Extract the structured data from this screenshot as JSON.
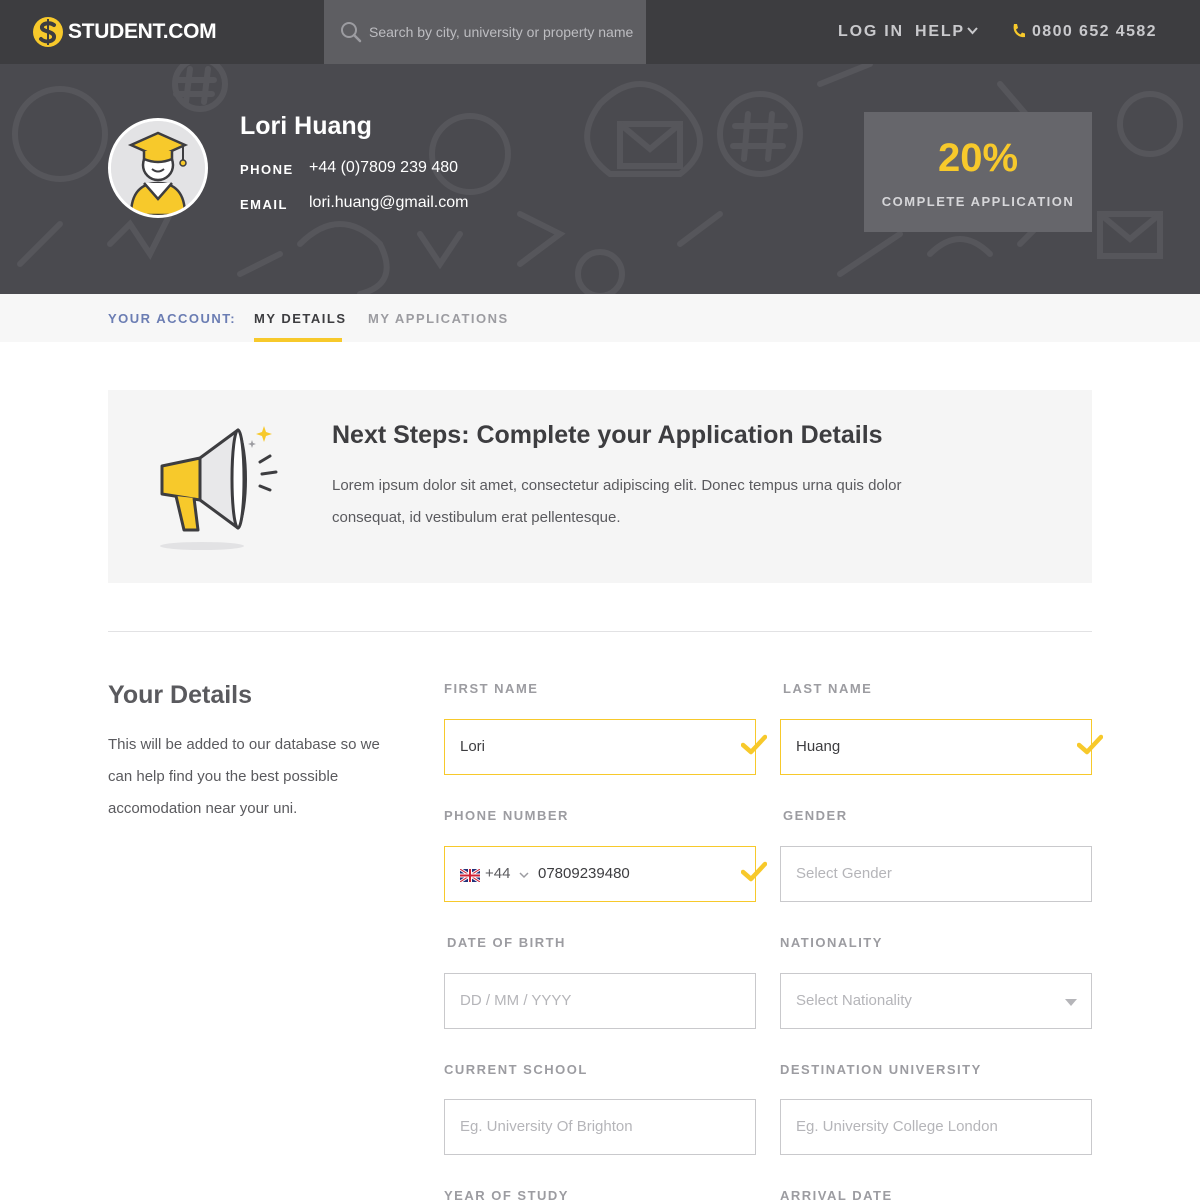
{
  "header": {
    "logo_text": "STUDENT.COM",
    "search_placeholder": "Search by city, university or property name",
    "login_label": "LOG IN",
    "help_label": "HELP",
    "phone_number": "0800 652 4582",
    "brand_color": "#f7c92b"
  },
  "profile": {
    "name": "Lori Huang",
    "phone_label": "PHONE",
    "phone_value": "+44 (0)7809 239 480",
    "email_label": "EMAIL",
    "email_value": "lori.huang@gmail.com",
    "completion_percent": "20%",
    "completion_label": "COMPLETE APPLICATION"
  },
  "tabs": {
    "prefix": "YOUR ACCOUNT:",
    "items": [
      {
        "label": "MY DETAILS",
        "active": true
      },
      {
        "label": "MY APPLICATIONS",
        "active": false
      }
    ]
  },
  "next_steps": {
    "title": "Next Steps: Complete your Application Details",
    "body": "Lorem ipsum dolor sit amet, consectetur adipiscing elit. Donec tempus urna quis dolor consequat, id vestibulum erat pellentesque."
  },
  "your_details": {
    "title": "Your Details",
    "description": "This will be added to our database so we can help find you the best possible accomodation near your uni."
  },
  "form": {
    "first_name": {
      "label": "FIRST NAME",
      "value": "Lori",
      "valid": true
    },
    "last_name": {
      "label": "LAST NAME",
      "value": "Huang",
      "valid": true
    },
    "phone": {
      "label": "PHONE NUMBER",
      "dial_code": "+44",
      "value": "07809239480",
      "valid": true
    },
    "gender": {
      "label": "GENDER",
      "placeholder": "Select Gender"
    },
    "dob": {
      "label": "DATE OF BIRTH",
      "placeholder": "DD / MM / YYYY"
    },
    "nationality": {
      "label": "NATIONALITY",
      "placeholder": "Select Nationality"
    },
    "current_school": {
      "label": "CURRENT SCHOOL",
      "placeholder": "Eg. University Of Brighton"
    },
    "destination_university": {
      "label": "DESTINATION UNIVERSITY",
      "placeholder": "Eg. University College London"
    },
    "year_of_study": {
      "label": "YEAR OF STUDY"
    },
    "arrival_date": {
      "label": "ARRIVAL DATE"
    }
  }
}
